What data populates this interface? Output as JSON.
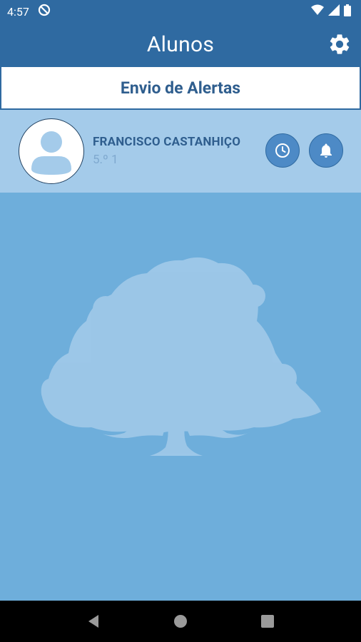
{
  "status_bar": {
    "time": "4:57",
    "icons": [
      "do-not-disturb-icon",
      "wifi-icon",
      "signal-icon",
      "battery-icon"
    ]
  },
  "app_bar": {
    "title": "Alunos",
    "settings_icon": "gear-icon"
  },
  "alerts_button": {
    "label": "Envio de Alertas"
  },
  "student": {
    "name": "FRANCISCO CASTANHIÇO",
    "class": "5.º 1",
    "avatar_icon": "person-icon",
    "actions": [
      "clock-icon",
      "bell-icon"
    ]
  },
  "background": {
    "image": "tree-silhouette"
  },
  "nav_bar": {
    "buttons": [
      "back-icon",
      "home-icon",
      "recents-icon"
    ]
  },
  "colors": {
    "primary": "#2f6aa1",
    "background": "#6eaedb",
    "row_background": "#a4cbea",
    "accent_text": "#2f5e8e"
  }
}
